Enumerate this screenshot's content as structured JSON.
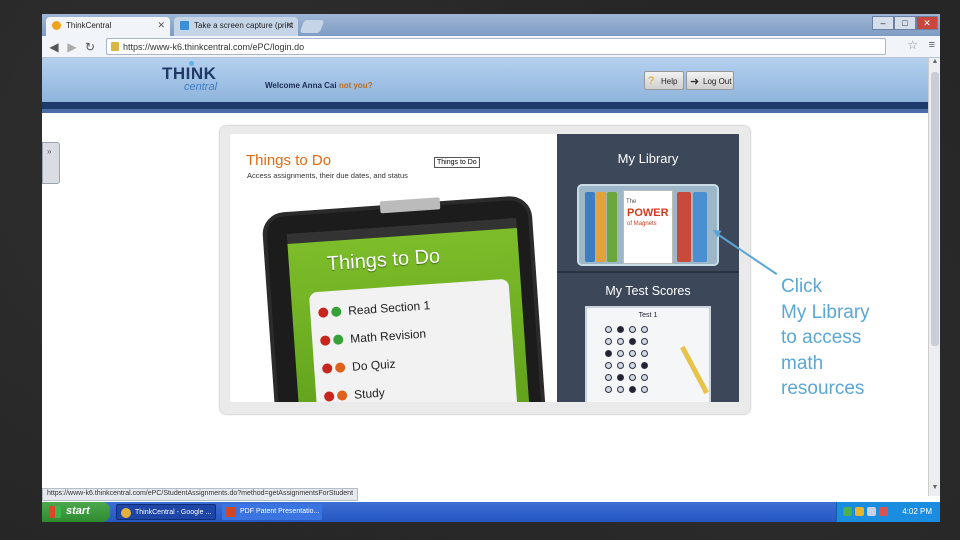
{
  "browser": {
    "tabs": [
      {
        "label": "ThinkCentral"
      },
      {
        "label": "Take a screen capture (print"
      }
    ],
    "url": "https://www-k6.thinkcentral.com/ePC/login.do",
    "window_controls": [
      "–",
      "□",
      "✕"
    ]
  },
  "site": {
    "logo_main": "THINK",
    "logo_sub": "central",
    "welcome_text": "Welcome Anna Cai",
    "not_you": "not you?",
    "help_label": "Help",
    "logout_label": "Log Out"
  },
  "panel": {
    "todo_title": "Things to Do",
    "todo_description": "Access assignments, their due dates, and status",
    "tooltip": "Things to Do",
    "tablet_heading": "Things to Do",
    "tasks": [
      {
        "label": "Read Section 1",
        "status_color": "#38a238"
      },
      {
        "label": "Math Revision",
        "status_color": "#38a238"
      },
      {
        "label": "Do Quiz",
        "status_color": "#e0611c"
      },
      {
        "label": "Study",
        "status_color": "#e0611c"
      }
    ],
    "library_title": "My Library",
    "book_title_top": "The",
    "book_title_main": "POWER",
    "book_title_sub": "of Magnets",
    "scores_title": "My Test Scores",
    "test_label": "Test 1"
  },
  "annotation": {
    "line1": "Click",
    "line2": "My Library",
    "line3": "to access",
    "line4": "math",
    "line5": "resources"
  },
  "statusbar": {
    "url": "https://www-k6.thinkcentral.com/ePC/StudentAssignments.do?method=getAssignmentsForStudent"
  },
  "taskbar": {
    "start_label": "start",
    "items": [
      {
        "label": "ThinkCentral - Google ..."
      },
      {
        "label": "PDF Patent Presentatio..."
      }
    ],
    "clock": "4:02 PM"
  }
}
